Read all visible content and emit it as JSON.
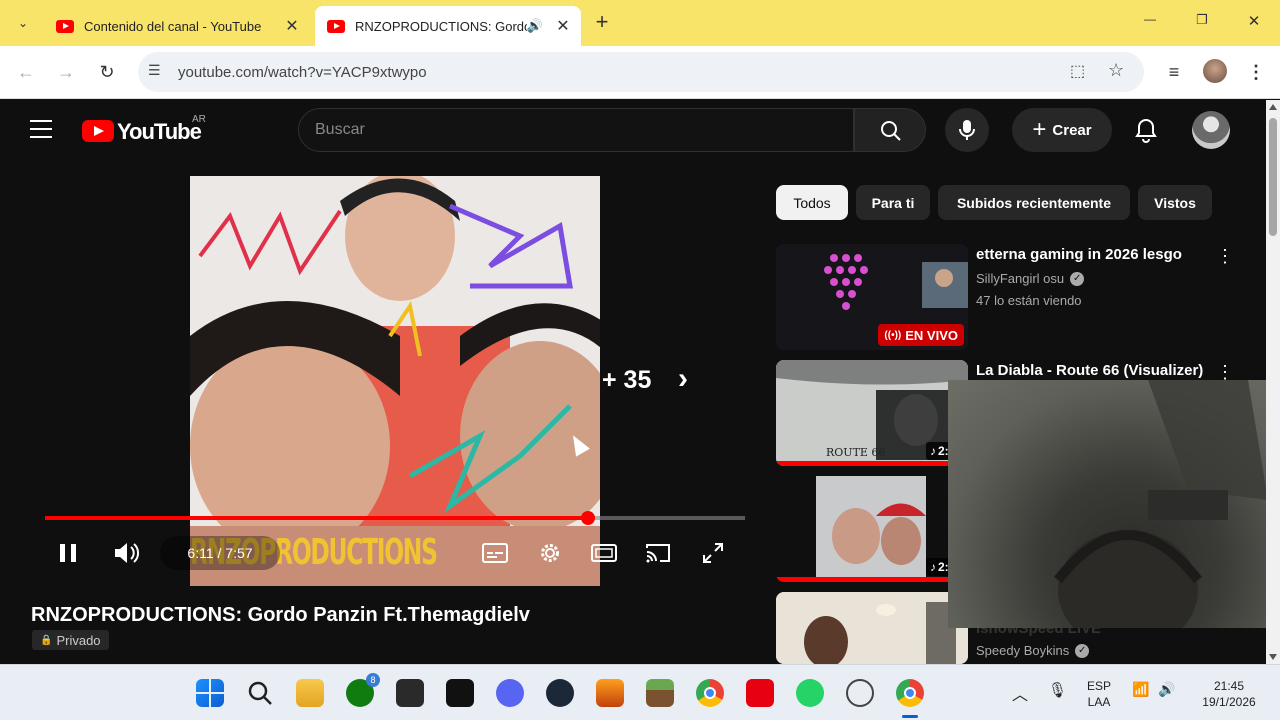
{
  "browser": {
    "tabs": [
      {
        "title": "Contenido del canal - YouTube",
        "active": false
      },
      {
        "title": "RNZOPRODUCTIONS: Gordo",
        "active": true
      }
    ],
    "new_tab_label": "+",
    "url": "youtube.com/watch?v=YACP9xtwypo",
    "window_controls": {
      "minimize": "—",
      "restore": "❐",
      "close": "✕"
    }
  },
  "youtube": {
    "logo_text": "YouTube",
    "region": "AR",
    "search_placeholder": "Buscar",
    "create_label": "Crear",
    "player": {
      "time": "6:11 / 7:57",
      "progress_fraction": 0.776,
      "overlay_count": "+ 35",
      "overlay_text": "RNZOPRODUCTIONS"
    },
    "video_title": "RNZOPRODUCTIONS: Gordo Panzin Ft.Themagdielv",
    "privacy": "Privado",
    "chips": [
      "Todos",
      "Para ti",
      "Subidos recientemente",
      "Vistos"
    ],
    "recommendations": [
      {
        "title": "etterna gaming in 2026 lesgo",
        "channel": "SillyFangirl osu",
        "meta": "47 lo están viendo",
        "badge": "EN VIVO"
      },
      {
        "title": "La Diabla - Route 66 (Visualizer)",
        "channel": "",
        "meta": "",
        "badge": "2:5"
      },
      {
        "title": "",
        "channel": "",
        "meta": "",
        "badge": "2:4"
      },
      {
        "title": "ishowSpeed LIVE",
        "channel": "Speedy Boykins",
        "meta": "",
        "badge": ""
      }
    ]
  },
  "taskbar": {
    "lang_top": "ESP",
    "lang_bottom": "LAA",
    "time": "21:45",
    "date": "19/1/2026",
    "xbox_badge": "8"
  }
}
